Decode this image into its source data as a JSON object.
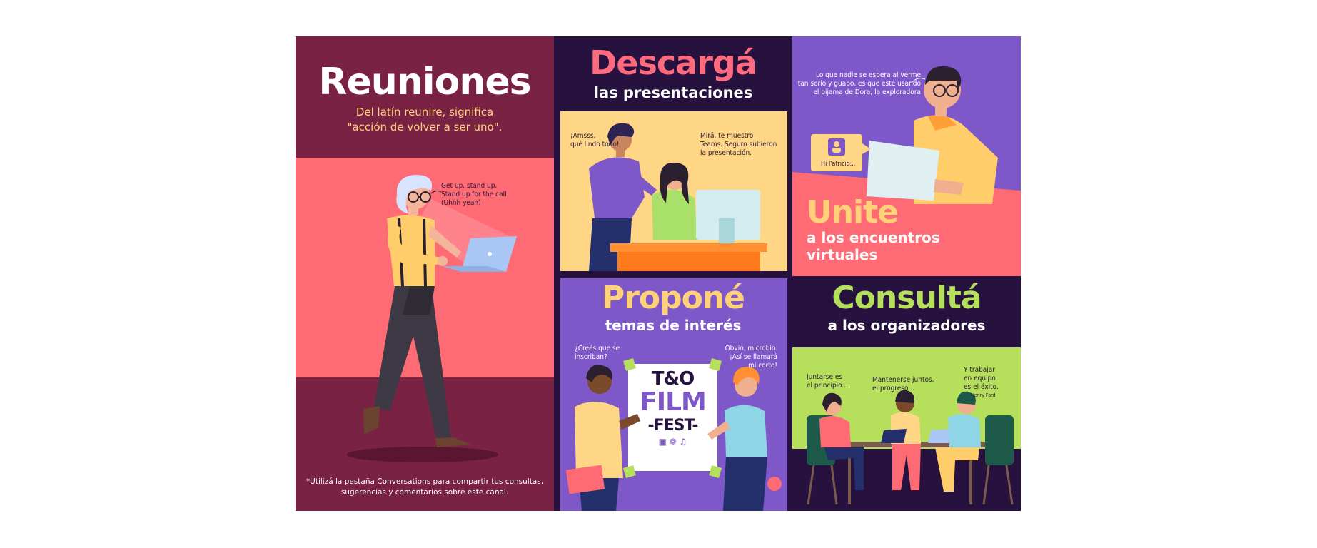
{
  "colors": {
    "maroon": "#7a2244",
    "coral": "#ff6b74",
    "deep_purple": "#27123f",
    "violet": "#7e57c8",
    "peach": "#ffd685",
    "lime": "#b6e05c",
    "pink_title": "#ff6b7e",
    "yellow_title": "#ffd27a",
    "orange": "#ff8f32"
  },
  "reuniones": {
    "title": "Reuniones",
    "definition_line1": "Del latín reunire, significa",
    "definition_line2": "\"acción de volver a ser uno\".",
    "speech_line1": "Get up, stand up,",
    "speech_line2": "Stand up for the call",
    "speech_line3": "(Uhhh yeah)",
    "footnote_line1": "*Utilizá la pestaña Conversations para compartir tus consultas,",
    "footnote_line2": "sugerencias y comentarios sobre este canal."
  },
  "descarga": {
    "title": "Descargá",
    "subtitle": "las presentaciones",
    "bubble_left_line1": "¡Amsss,",
    "bubble_left_line2": "qué lindo todo!",
    "bubble_right_line1": "Mirá, te muestro",
    "bubble_right_line2": "Teams. Seguro subieron",
    "bubble_right_line3": "la presentación."
  },
  "unite": {
    "speech_line1": "Lo que nadie se espera al verme",
    "speech_line2": "tan serio y guapo, es que esté usando",
    "speech_line3": "el pijama de Dora, la exploradora",
    "chat_label": "Hi Patricio...",
    "title": "Unite",
    "subtitle_line1": "a los encuentros",
    "subtitle_line2": "virtuales"
  },
  "propone": {
    "title": "Proponé",
    "subtitle": "temas de interés",
    "bubble_left_line1": "¿Creés que se",
    "bubble_left_line2": "inscriban?",
    "bubble_right_line1": "Obvio, microbio.",
    "bubble_right_line2": "¡Así se llamará",
    "bubble_right_line3": "mi corto!",
    "poster_line1": "T&O",
    "poster_line2": "FILM",
    "poster_line3": "-FEST-"
  },
  "consulta": {
    "title": "Consultá",
    "subtitle": "a los organizadores",
    "bubble1_line1": "Juntarse es",
    "bubble1_line2": "el principio...",
    "bubble2_line1": "Mantenerse juntos,",
    "bubble2_line2": "el progreso...",
    "bubble3_line1": "Y trabajar",
    "bubble3_line2": "en equipo",
    "bubble3_line3": "es el éxito.",
    "bubble3_author": "Henry Ford"
  }
}
